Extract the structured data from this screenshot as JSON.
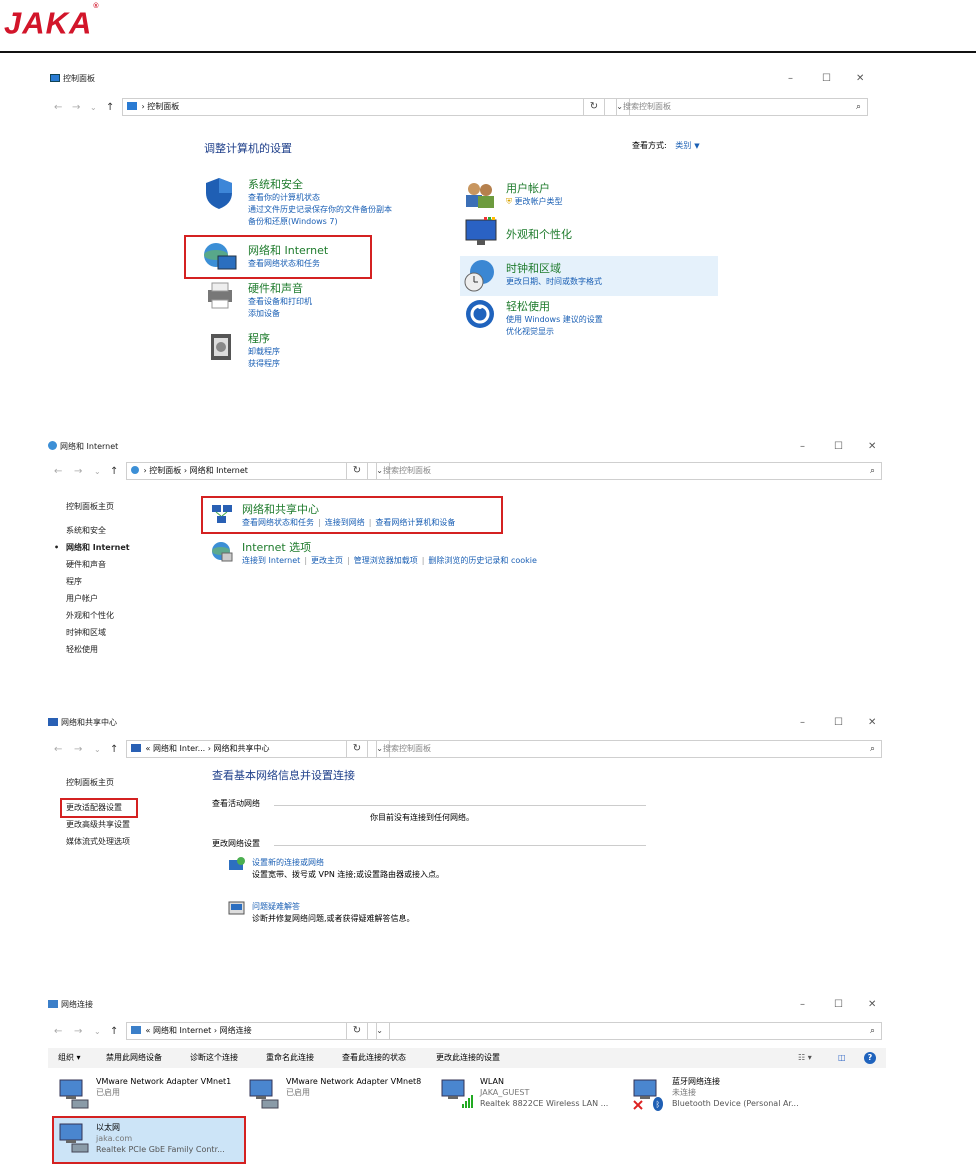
{
  "header": {
    "logo": "JAKA",
    "reg": "®"
  },
  "win1": {
    "title": "控制面板",
    "address": "控制面板",
    "search_placeholder": "搜索控制面板",
    "heading": "调整计算机的设置",
    "view_label": "查看方式:",
    "view_value": "类别",
    "categories_left": [
      {
        "title": "系统和安全",
        "links": [
          "查看你的计算机状态",
          "通过文件历史记录保存你的文件备份副本",
          "备份和还原(Windows 7)"
        ]
      },
      {
        "title": "网络和 Internet",
        "links": [
          "查看网络状态和任务"
        ]
      },
      {
        "title": "硬件和声音",
        "links": [
          "查看设备和打印机",
          "添加设备"
        ]
      },
      {
        "title": "程序",
        "links": [
          "卸载程序",
          "获得程序"
        ]
      }
    ],
    "categories_right": [
      {
        "title": "用户帐户",
        "links": [
          "更改帐户类型"
        ]
      },
      {
        "title": "外观和个性化",
        "links": []
      },
      {
        "title": "时钟和区域",
        "links": [
          "更改日期、时间或数字格式"
        ]
      },
      {
        "title": "轻松使用",
        "links": [
          "使用 Windows 建议的设置",
          "优化视觉显示"
        ]
      }
    ]
  },
  "win2": {
    "title": "网络和 Internet",
    "breadcrumb": [
      "控制面板",
      "网络和 Internet"
    ],
    "search_placeholder": "搜索控制面板",
    "sidebar": [
      "控制面板主页",
      "系统和安全",
      "网络和 Internet",
      "硬件和声音",
      "程序",
      "用户帐户",
      "外观和个性化",
      "时钟和区域",
      "轻松使用"
    ],
    "items": [
      {
        "title": "网络和共享中心",
        "links": [
          "查看网络状态和任务",
          "连接到网络",
          "查看网络计算机和设备"
        ]
      },
      {
        "title": "Internet 选项",
        "links": [
          "连接到 Internet",
          "更改主页",
          "管理浏览器加载项",
          "删除浏览的历史记录和 cookie"
        ]
      }
    ]
  },
  "win3": {
    "title": "网络和共享中心",
    "breadcrumb": [
      "«",
      "网络和 Inter...",
      "网络和共享中心"
    ],
    "search_placeholder": "搜索控制面板",
    "sidebar": [
      "控制面板主页",
      "更改适配器设置",
      "更改高级共享设置",
      "媒体流式处理选项"
    ],
    "heading": "查看基本网络信息并设置连接",
    "active_label": "查看活动网络",
    "active_msg": "你目前没有连接到任何网络。",
    "change_label": "更改网络设置",
    "tasks": [
      {
        "title": "设置新的连接或网络",
        "desc": "设置宽带、拨号或 VPN 连接;或设置路由器或接入点。"
      },
      {
        "title": "问题疑难解答",
        "desc": "诊断并修复网络问题,或者获得疑难解答信息。"
      }
    ]
  },
  "win4": {
    "title": "网络连接",
    "breadcrumb": [
      "«",
      "网络和 Internet",
      "网络连接"
    ],
    "toolbar": [
      "组织 ▾",
      "禁用此网络设备",
      "诊断这个连接",
      "重命名此连接",
      "查看此连接的状态",
      "更改此连接的设置"
    ],
    "adapters": [
      {
        "name": "VMware Network Adapter VMnet1",
        "status": "已启用",
        "device": ""
      },
      {
        "name": "VMware Network Adapter VMnet8",
        "status": "已启用",
        "device": ""
      },
      {
        "name": "WLAN",
        "status": "JAKA_GUEST",
        "device": "Realtek 8822CE Wireless LAN ..."
      },
      {
        "name": "蓝牙网络连接",
        "status": "未连接",
        "device": "Bluetooth Device (Personal Ar..."
      },
      {
        "name": "以太网",
        "status": "jaka.com",
        "device": "Realtek PCIe GbE Family Contr..."
      }
    ]
  },
  "colors": {
    "accent": "#1a5fb4",
    "highlight": "#d42121",
    "brand": "#d2152a"
  }
}
